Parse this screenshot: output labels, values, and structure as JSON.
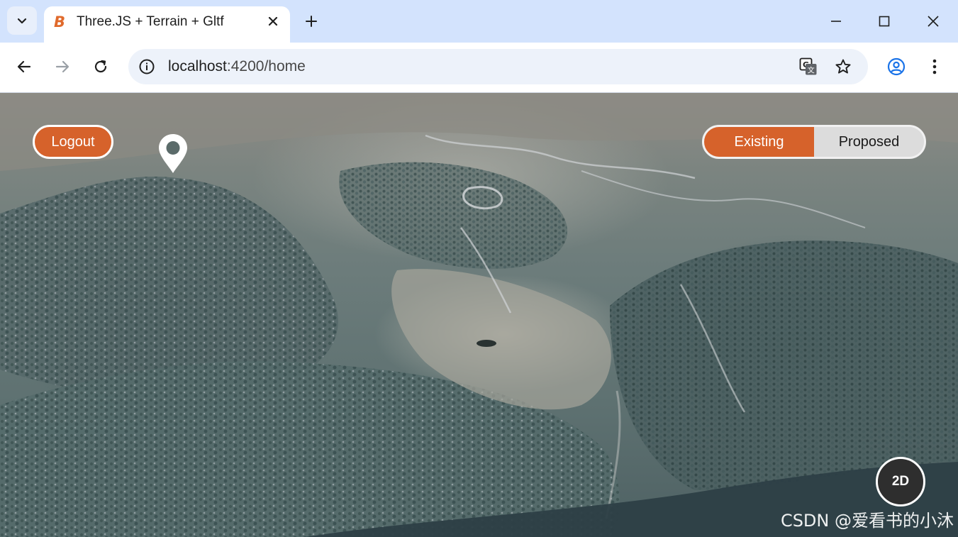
{
  "browser": {
    "tab": {
      "title": "Three.JS + Terrain + Gltf",
      "favicon_letter": "B",
      "favicon_color": "#e06a2c"
    },
    "address_bar": {
      "host": "localhost",
      "rest": ":4200/home"
    },
    "icons": {
      "tab_menu": "chevron-down-icon",
      "tab_close": "close-icon",
      "new_tab": "plus-icon",
      "minimize": "minimize-icon",
      "maximize": "maximize-icon",
      "close_window": "close-icon",
      "back": "arrow-left-icon",
      "forward": "arrow-right-icon",
      "reload": "reload-icon",
      "site_info": "info-icon",
      "translate": "translate-icon",
      "bookmark": "star-icon",
      "profile": "profile-icon",
      "menu": "kebab-menu-icon"
    }
  },
  "app": {
    "logout_label": "Logout",
    "toggle": {
      "options": [
        "Existing",
        "Proposed"
      ],
      "active": "Existing"
    },
    "view_mode_label": "2D",
    "accent_color": "#d6622b",
    "watermark": "CSDN @爱看书的小沐"
  }
}
